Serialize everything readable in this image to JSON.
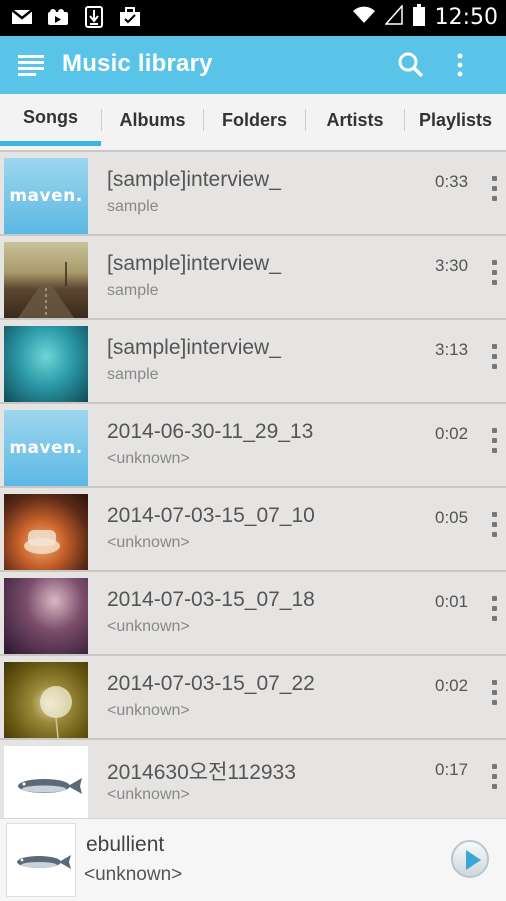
{
  "status_bar": {
    "time": "12:50",
    "icons": [
      "gmail-icon",
      "media-icon",
      "download-icon",
      "briefcase-icon"
    ]
  },
  "app_bar": {
    "title": "Music library",
    "color": "#5ac4e8"
  },
  "tabs": [
    {
      "label": "Songs",
      "active": true
    },
    {
      "label": "Albums",
      "active": false
    },
    {
      "label": "Folders",
      "active": false
    },
    {
      "label": "Artists",
      "active": false
    },
    {
      "label": "Playlists",
      "active": false
    }
  ],
  "songs": [
    {
      "title": "[sample]interview_",
      "subtitle": "sample",
      "duration": "0:33",
      "art": "maven"
    },
    {
      "title": "[sample]interview_",
      "subtitle": "sample",
      "duration": "3:30",
      "art": "road"
    },
    {
      "title": "[sample]interview_",
      "subtitle": "sample",
      "duration": "3:13",
      "art": "teal"
    },
    {
      "title": "2014-06-30-11_29_13",
      "subtitle": "<unknown>",
      "duration": "0:02",
      "art": "maven"
    },
    {
      "title": "2014-07-03-15_07_10",
      "subtitle": "<unknown>",
      "duration": "0:05",
      "art": "teacup"
    },
    {
      "title": "2014-07-03-15_07_18",
      "subtitle": "<unknown>",
      "duration": "0:01",
      "art": "purple"
    },
    {
      "title": "2014-07-03-15_07_22",
      "subtitle": "<unknown>",
      "duration": "0:02",
      "art": "dandelion"
    },
    {
      "title": "2014630오전112933",
      "subtitle": "<unknown>",
      "duration": "0:17",
      "art": "fish"
    }
  ],
  "art_labels": {
    "maven": "maven.",
    "fish_caption": "ebullient"
  },
  "now_playing": {
    "title": "ebullient",
    "subtitle": "<unknown>"
  }
}
